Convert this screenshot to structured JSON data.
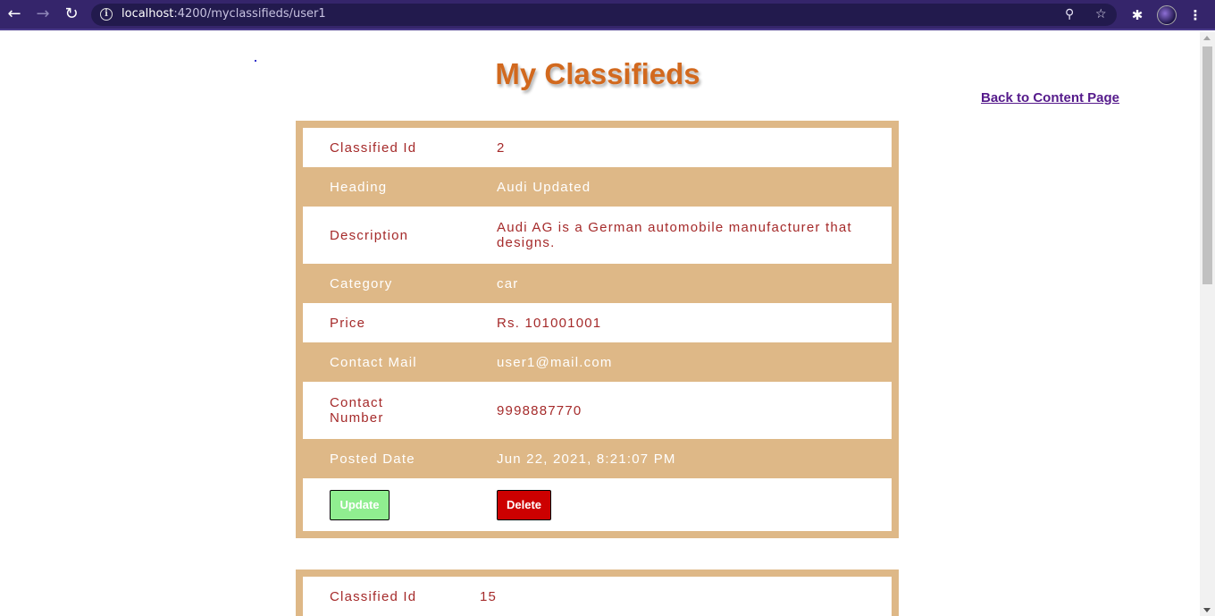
{
  "browser": {
    "url_host": "localhost",
    "url_path": ":4200/myclassifieds/user1"
  },
  "page": {
    "title": "My Classifieds",
    "back_link": "Back to Content Page"
  },
  "labels": {
    "id": "Classified Id",
    "heading": "Heading",
    "description": "Description",
    "category": "Category",
    "price": "Price",
    "mail": "Contact Mail",
    "number": "Contact Number",
    "date": "Posted Date",
    "update": "Update",
    "delete": "Delete"
  },
  "classifieds": [
    {
      "id": "2",
      "heading": "Audi Updated",
      "description": "Audi AG is a German automobile manufacturer that designs.",
      "category": "car",
      "price": "Rs. 101001001",
      "mail": "user1@mail.com",
      "number": "9998887770",
      "date": "Jun 22, 2021, 8:21:07 PM"
    },
    {
      "id": "15"
    }
  ],
  "colors": {
    "title": "#d2691e",
    "card_bg": "#deb887",
    "text_brown": "#a52a2a",
    "update_btn": "#90ee90",
    "delete_btn": "#cc0000"
  }
}
